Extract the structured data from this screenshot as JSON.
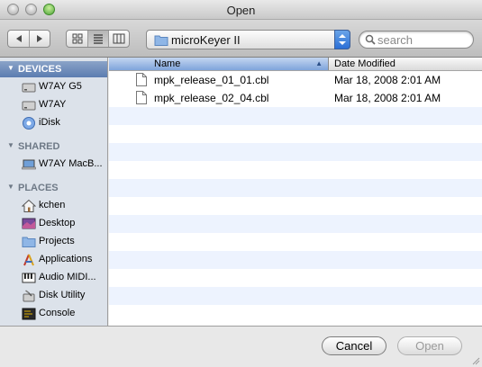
{
  "window": {
    "title": "Open"
  },
  "toolbar": {
    "back_icon": "back-arrow-icon",
    "forward_icon": "forward-arrow-icon",
    "view_modes": [
      "icon-view",
      "list-view",
      "column-view"
    ],
    "active_view": "list-view",
    "location": "microKeyer II",
    "search_placeholder": "search"
  },
  "sidebar": {
    "devices_header": "DEVICES",
    "devices": [
      {
        "label": "W7AY G5",
        "icon": "hard-drive-icon"
      },
      {
        "label": "W7AY",
        "icon": "hard-drive-icon"
      },
      {
        "label": "iDisk",
        "icon": "idisk-icon"
      }
    ],
    "shared_header": "SHARED",
    "shared": [
      {
        "label": "W7AY MacB...",
        "icon": "computer-icon"
      }
    ],
    "places_header": "PLACES",
    "places": [
      {
        "label": "kchen",
        "icon": "home-icon"
      },
      {
        "label": "Desktop",
        "icon": "desktop-icon"
      },
      {
        "label": "Projects",
        "icon": "folder-icon"
      },
      {
        "label": "Applications",
        "icon": "applications-icon"
      },
      {
        "label": "Audio MIDI...",
        "icon": "audio-midi-icon"
      },
      {
        "label": "Disk Utility",
        "icon": "disk-utility-icon"
      },
      {
        "label": "Console",
        "icon": "console-icon"
      }
    ]
  },
  "filelist": {
    "columns": [
      "Name",
      "Date Modified"
    ],
    "files": [
      {
        "name": "mpk_release_01_01.cbl",
        "date": "Mar 18, 2008 2:01 AM"
      },
      {
        "name": "mpk_release_02_04.cbl",
        "date": "Mar 18, 2008 2:01 AM"
      }
    ]
  },
  "buttons": {
    "cancel": "Cancel",
    "open": "Open"
  },
  "colors": {
    "sidebar_bg": "#dce2ea",
    "stripe": "#edf3fe",
    "accent": "#2b6fd6"
  }
}
